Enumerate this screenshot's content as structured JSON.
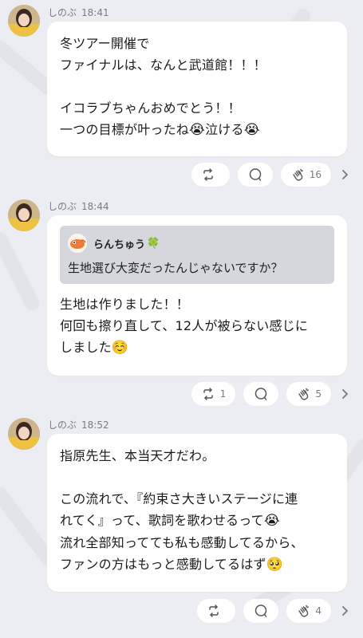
{
  "posts": [
    {
      "author": "しのぶ",
      "time": "18:41",
      "lines": [
        "冬ツアー開催で",
        "ファイナルは、なんと武道館！！！",
        "",
        "イコラブちゃんおめでとう！！"
      ],
      "line5_text1": "一つの目標が叶ったね",
      "line5_emoji1": "😭",
      "line5_text2": "泣ける",
      "line5_emoji2": "😭",
      "retweet_count": "",
      "clap_count": "16"
    },
    {
      "author": "しのぶ",
      "time": "18:44",
      "quote": {
        "author": "らんちゅう",
        "badge": "🍀",
        "text": "生地選び大変だったんじゃないですか？"
      },
      "lines": [
        "生地は作りました！！",
        "何回も擦り直して、12人が被らない感じに"
      ],
      "last_text": "しました",
      "last_emoji": "☺️",
      "retweet_count": "1",
      "clap_count": "5"
    },
    {
      "author": "しのぶ",
      "time": "18:52",
      "lines": [
        "指原先生、本当天才だわ。",
        "",
        "この流れで、『約束さ大きいステージに連",
        "れてく』って、歌詞を歌わせるって",
        "流れ全部知ってても私も感動してるから、",
        "ファンの方はもっと感動してるはず"
      ],
      "line4_emoji": "😭",
      "line6_emoji": "🥺",
      "retweet_count": "",
      "clap_count": "4"
    }
  ],
  "colors": {
    "background": "#ecedf2",
    "bubble": "#ffffff",
    "quote": "#d6d7dc",
    "meta": "#7a7b84"
  },
  "icons": [
    "repost-icon",
    "comment-icon",
    "clap-icon",
    "chevron-right-icon"
  ]
}
